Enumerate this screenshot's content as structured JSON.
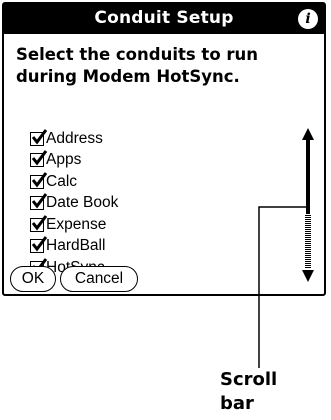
{
  "dialog": {
    "title": "Conduit Setup",
    "info_icon": "i",
    "instructions": "Select the conduits to run during Modem HotSync.",
    "conduits": [
      {
        "label": "Address",
        "checked": true
      },
      {
        "label": "Apps",
        "checked": true
      },
      {
        "label": "Calc",
        "checked": true
      },
      {
        "label": "Date Book",
        "checked": true
      },
      {
        "label": "Expense",
        "checked": true
      },
      {
        "label": "HardBall",
        "checked": true
      },
      {
        "label": "HotSync",
        "checked": true
      }
    ],
    "buttons": {
      "ok": "OK",
      "cancel": "Cancel"
    }
  },
  "annotation": {
    "label": "Scroll bar"
  }
}
